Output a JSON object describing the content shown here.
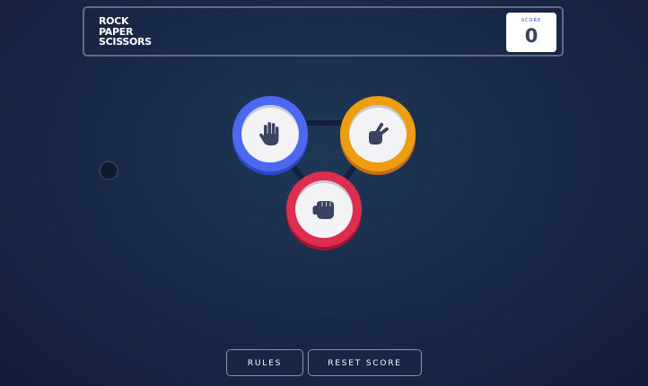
{
  "header": {
    "title_lines": [
      "ROCK",
      "PAPER",
      "SCISSORS"
    ],
    "score_label": "SCORE",
    "score_value": "0"
  },
  "choices": [
    {
      "name": "paper",
      "icon": "paper-hand-icon",
      "color": "#4c68f0"
    },
    {
      "name": "scissors",
      "icon": "scissors-hand-icon",
      "color": "#ec9e0e"
    },
    {
      "name": "rock",
      "icon": "rock-fist-icon",
      "color": "#dc2e4e"
    }
  ],
  "buttons": {
    "rules_label": "RULES",
    "reset_label": "RESET SCORE"
  },
  "colors": {
    "background": "#1f3756",
    "score_text": "#3b4363",
    "score_label": "#2a45c2"
  }
}
